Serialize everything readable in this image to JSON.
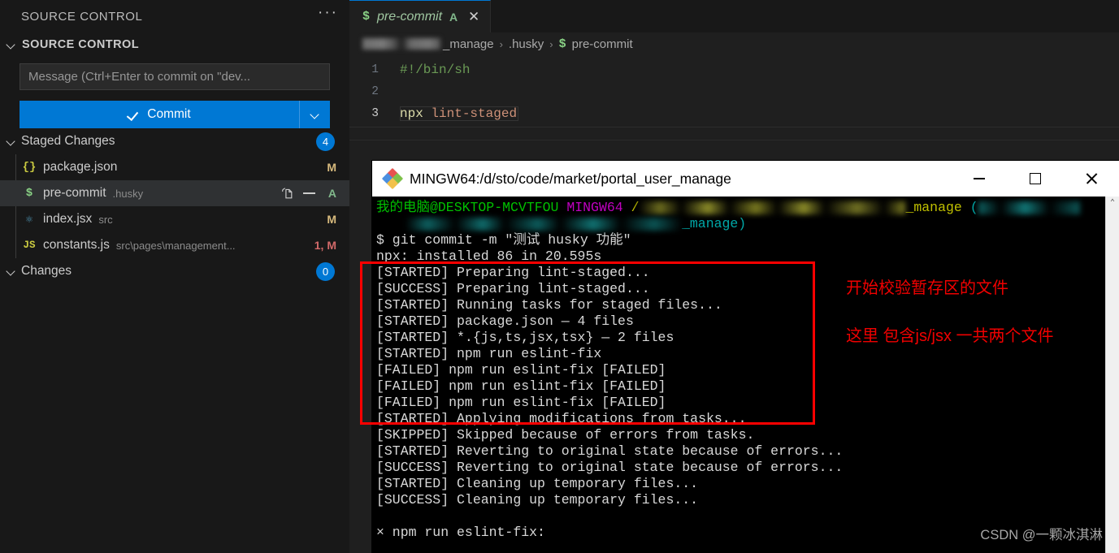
{
  "sidebar": {
    "view_title": "SOURCE CONTROL",
    "more_actions": "···",
    "section_title": "SOURCE CONTROL",
    "commit_input_placeholder": "Message (Ctrl+Enter to commit on \"dev...",
    "commit_button_label": "Commit",
    "groups": [
      {
        "label": "Staged Changes",
        "count": "4",
        "files": [
          {
            "icon": "json-icon",
            "glyph": "{}",
            "icon_class": "ic-json",
            "name": "package.json",
            "path": "",
            "status": "M",
            "status_class": "st-M",
            "selected": false
          },
          {
            "icon": "shell-script-icon",
            "glyph": "$",
            "icon_class": "ic-sh",
            "name": "pre-commit",
            "path": ".husky",
            "status": "A",
            "status_class": "st-A",
            "selected": true
          },
          {
            "icon": "react-icon",
            "glyph": "⚛",
            "icon_class": "ic-react",
            "name": "index.jsx",
            "path": "src",
            "status": "M",
            "status_class": "st-M",
            "selected": false
          },
          {
            "icon": "javascript-icon",
            "glyph": "JS",
            "icon_class": "ic-js",
            "name": "constants.js",
            "path": "src\\pages\\management...",
            "status": "1, M",
            "status_class": "st-MM",
            "selected": false
          }
        ]
      },
      {
        "label": "Changes",
        "count": "0",
        "files": []
      }
    ]
  },
  "editor": {
    "tab": {
      "icon_glyph": "$",
      "label": "pre-commit",
      "badge": "A",
      "close_glyph": "✕"
    },
    "breadcrumb": {
      "root_suffix": "_manage",
      "sep": "›",
      "folder": ".husky",
      "file_icon_glyph": "$",
      "file": "pre-commit"
    },
    "code": [
      {
        "num": "1",
        "text": "#!/bin/sh",
        "kind": "comment"
      },
      {
        "num": "2",
        "text": "",
        "kind": "plain"
      },
      {
        "num": "3",
        "text": "npx lint-staged",
        "kind": "cmd"
      }
    ]
  },
  "terminal": {
    "title": "MINGW64:/d/sto/code/market/portal_user_manage",
    "window_controls": {
      "minimize": "minimize-button",
      "maximize": "maximize-button",
      "close": "close-button"
    },
    "scroll_up_glyph": "⌃",
    "prompt": {
      "user_host": "我的电脑@DESKTOP-MCVTFOU",
      "shell": "MINGW64",
      "slash": "/",
      "path_suffix": "_manage",
      "branch_open": "(",
      "branch_suffix": "_manage)"
    },
    "command": "$ git commit -m \"测试 husky 功能\"",
    "output": [
      "npx: installed 86 in 20.595s",
      "[STARTED] Preparing lint-staged...",
      "[SUCCESS] Preparing lint-staged...",
      "[STARTED] Running tasks for staged files...",
      "[STARTED] package.json — 4 files",
      "[STARTED] *.{js,ts,jsx,tsx} — 2 files",
      "[STARTED] npm run eslint-fix",
      "[FAILED] npm run eslint-fix [FAILED]",
      "[FAILED] npm run eslint-fix [FAILED]",
      "[FAILED] npm run eslint-fix [FAILED]",
      "[STARTED] Applying modifications from tasks...",
      "[SKIPPED] Skipped because of errors from tasks.",
      "[STARTED] Reverting to original state because of errors...",
      "[SUCCESS] Reverting to original state because of errors...",
      "[STARTED] Cleaning up temporary files...",
      "[SUCCESS] Cleaning up temporary files...",
      "",
      "× npm run eslint-fix:"
    ]
  },
  "annotations": {
    "color": "#ff0000",
    "note1": "开始校验暂存区的文件",
    "note2": "这里 包含js/jsx 一共两个文件"
  },
  "watermark": "CSDN @一颗冰淇淋"
}
